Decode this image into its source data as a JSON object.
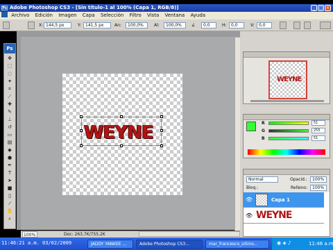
{
  "app": {
    "title": "Adobe Photoshop CS3 - [Sin título-1 al 100% (Capa 1, RGB/8)]",
    "logo": "Ps",
    "window_buttons": [
      "_",
      "□",
      "×"
    ]
  },
  "menu": [
    "Archivo",
    "Edición",
    "Imagen",
    "Capa",
    "Selección",
    "Filtro",
    "Vista",
    "Ventana",
    "Ayuda"
  ],
  "options_bar": {
    "x_label": "X:",
    "x_value": "144,5 px",
    "y_label": "Y:",
    "y_value": "141,5 px",
    "w_label": "An:",
    "w_value": "100,0%",
    "h_label": "Al:",
    "h_value": "100,0%",
    "angle_value": "0,0",
    "hskew_label": "H:",
    "hskew_value": "0,0",
    "vskew_label": "V:",
    "vskew_value": "0,0"
  },
  "canvas_text": "WEYNE",
  "status": {
    "zoom": "100%",
    "doc_info": "Doc: 263,7K/755,2K"
  },
  "navigator": {
    "thumb_text": "WEYNE"
  },
  "color_panel": {
    "r_label": "R",
    "g_label": "G",
    "b_label": "B",
    "r_value": "51",
    "g_value": "255",
    "b_value": "51",
    "foreground_color": "#33ff33",
    "background_color": "#ffffff"
  },
  "layers_panel": {
    "blend_mode": "Normal",
    "opacity_label": "Opacid.:",
    "opacity_value": "100%",
    "lock_label": "Bloq.:",
    "fill_label": "Relleno:",
    "fill_value": "100%",
    "layers": [
      {
        "name": "Capa 1",
        "selected": true
      },
      {
        "name": "WEYNE",
        "selected": false
      }
    ]
  },
  "taskbar": {
    "time_overlay": "11:46:21 a.m. 03/02/2009",
    "items": [
      {
        "label": "JADDY YANKEE ...",
        "active": false
      },
      {
        "label": "Adobe Photoshop CS3...",
        "active": true
      },
      {
        "label": "mar_francesco_siSino...",
        "active": false
      }
    ],
    "clock": "11:46 a.m."
  },
  "colors": {
    "title_blue": "#2a56c6",
    "text_red": "#b01515",
    "selection_blue": "#3d95ee"
  }
}
